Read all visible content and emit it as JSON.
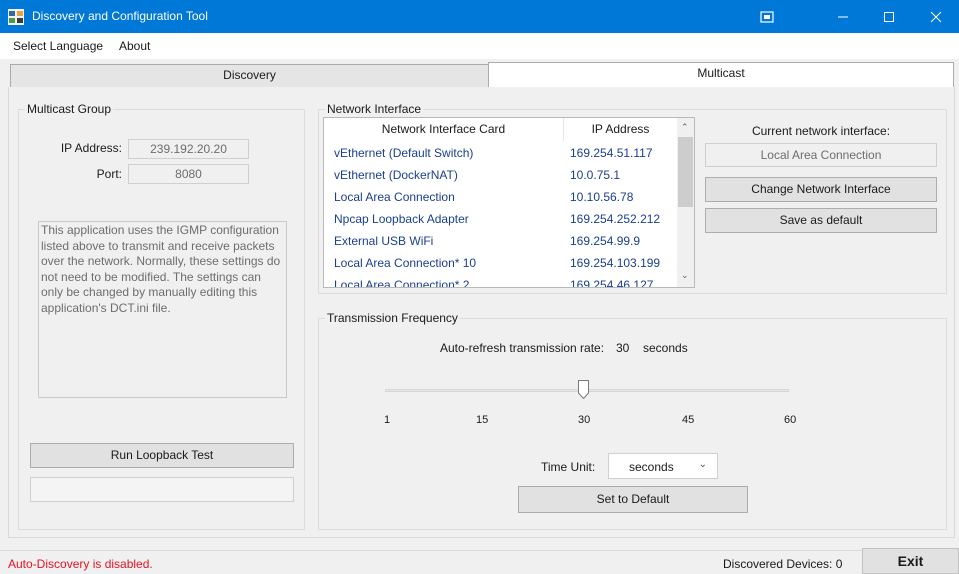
{
  "window": {
    "title": "Discovery and Configuration Tool",
    "accent": "#0078d7"
  },
  "menu": {
    "items": [
      "Select Language",
      "About"
    ]
  },
  "tabs": [
    {
      "label": "Discovery",
      "active": false
    },
    {
      "label": "Multicast",
      "active": true
    }
  ],
  "multicast_group": {
    "title": "Multicast Group",
    "ip_label": "IP Address:",
    "ip_value": "239.192.20.20",
    "port_label": "Port:",
    "port_value": "8080",
    "info_text": "This application uses the IGMP configuration listed above to transmit and receive packets over the network. Normally, these settings do not need to be modified. The settings can only be changed by manually editing this application's DCT.ini file.",
    "loopback_button": "Run Loopback Test",
    "loopback_result": ""
  },
  "network_interface": {
    "title": "Network Interface",
    "columns": [
      "Network Interface Card",
      "IP Address"
    ],
    "rows": [
      {
        "name": "vEthernet (Default Switch)",
        "ip": "169.254.51.117"
      },
      {
        "name": "vEthernet (DockerNAT)",
        "ip": "10.0.75.1"
      },
      {
        "name": "Local Area Connection",
        "ip": "10.10.56.78"
      },
      {
        "name": "Npcap Loopback Adapter",
        "ip": "169.254.252.212"
      },
      {
        "name": "External USB WiFi",
        "ip": "169.254.99.9"
      },
      {
        "name": "Local Area Connection* 10",
        "ip": "169.254.103.199"
      },
      {
        "name": "Local Area Connection* 2",
        "ip": "169.254.46.127"
      }
    ],
    "current_label": "Current network interface:",
    "current_value": "Local Area Connection",
    "change_button": "Change Network Interface",
    "save_default_button": "Save as default"
  },
  "transmission": {
    "title": "Transmission Frequency",
    "rate_label": "Auto-refresh transmission rate:",
    "rate_value": "30",
    "rate_unit": "seconds",
    "slider_value": 30,
    "slider_min": 1,
    "slider_max": 60,
    "ticks": [
      "1",
      "15",
      "30",
      "45",
      "60"
    ],
    "time_unit_label": "Time Unit:",
    "time_unit_value": "seconds",
    "set_default_button": "Set to Default"
  },
  "status": {
    "message": "Auto-Discovery is disabled.",
    "message_color": "#e81123",
    "devices_label": "Discovered Devices: 0",
    "exit_button": "Exit"
  }
}
